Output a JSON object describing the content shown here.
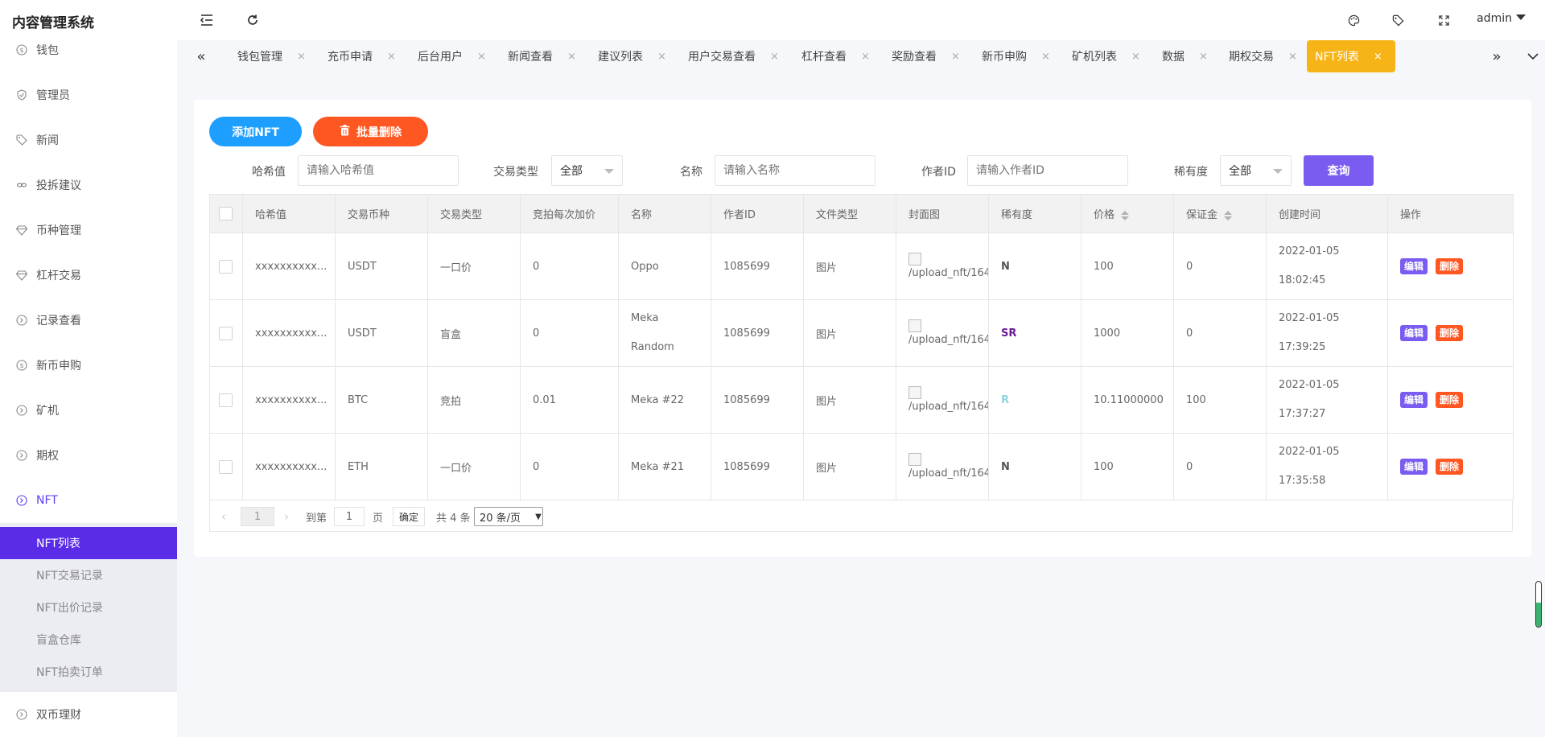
{
  "app_title": "内容管理系统",
  "header": {
    "user": "admin"
  },
  "sidebar": {
    "items": [
      {
        "label": "钱包",
        "icon": "dollar-circle-icon"
      },
      {
        "label": "管理员",
        "icon": "shield-icon"
      },
      {
        "label": "新闻",
        "icon": "tag-icon"
      },
      {
        "label": "投拆建议",
        "icon": "link-icon"
      },
      {
        "label": "币种管理",
        "icon": "diamond-icon"
      },
      {
        "label": "杠杆交易",
        "icon": "diamond-icon"
      },
      {
        "label": "记录查看",
        "icon": "circle-arrow-icon"
      },
      {
        "label": "新币申购",
        "icon": "dollar-circle-icon"
      },
      {
        "label": "矿机",
        "icon": "circle-arrow-icon"
      },
      {
        "label": "期权",
        "icon": "circle-arrow-icon"
      },
      {
        "label": "NFT",
        "icon": "circle-arrow-icon"
      },
      {
        "label": "双币理财",
        "icon": "circle-arrow-icon"
      }
    ],
    "nft_sub": [
      "NFT列表",
      "NFT交易记录",
      "NFT出价记录",
      "盲盒仓库",
      "NFT拍卖订单"
    ]
  },
  "tabs": [
    "钱包管理",
    "充币申请",
    "后台用户",
    "新闻查看",
    "建议列表",
    "用户交易查看",
    "杠杆查看",
    "奖励查看",
    "新币申购",
    "矿机列表",
    "数据",
    "期权交易",
    "NFT列表"
  ],
  "toolbar": {
    "add_label": "添加NFT",
    "batch_delete_label": "批量删除"
  },
  "filters": {
    "hash_label": "哈希值",
    "hash_placeholder": "请输入哈希值",
    "trade_type_label": "交易类型",
    "trade_type_value": "全部",
    "name_label": "名称",
    "name_placeholder": "请输入名称",
    "author_label": "作者ID",
    "author_placeholder": "请输入作者ID",
    "rarity_label": "稀有度",
    "rarity_value": "全部",
    "query_label": "查询"
  },
  "table": {
    "columns": [
      "哈希值",
      "交易币种",
      "交易类型",
      "竞拍每次加价",
      "名称",
      "作者ID",
      "文件类型",
      "封面图",
      "稀有度",
      "价格",
      "保证金",
      "创建时间",
      "操作"
    ],
    "rows": [
      {
        "hash": "xxxxxxxxxx...",
        "coin": "USDT",
        "type": "一口价",
        "increment": "0",
        "name": "Oppo",
        "author": "1085699",
        "file_type": "图片",
        "cover": "/upload_nft/1641",
        "rarity": "N",
        "rarity_color": "#555555",
        "price": "100",
        "deposit": "0",
        "date": "2022-01-05",
        "time": "18:02:45"
      },
      {
        "hash": "xxxxxxxxxx...",
        "coin": "USDT",
        "type": "盲盒",
        "increment": "0",
        "name": "Meka Random",
        "author": "1085699",
        "file_type": "图片",
        "cover": "/upload_nft/1641",
        "rarity": "SR",
        "rarity_color": "#6a1b9a",
        "price": "1000",
        "deposit": "0",
        "date": "2022-01-05",
        "time": "17:39:25"
      },
      {
        "hash": "xxxxxxxxxx...",
        "coin": "BTC",
        "type": "竞拍",
        "increment": "0.01",
        "name": "Meka #22",
        "author": "1085699",
        "file_type": "图片",
        "cover": "/upload_nft/1641",
        "rarity": "R",
        "rarity_color": "#8fd3df",
        "price": "10.11000000",
        "deposit": "100",
        "date": "2022-01-05",
        "time": "17:37:27"
      },
      {
        "hash": "xxxxxxxxxx...",
        "coin": "ETH",
        "type": "一口价",
        "increment": "0",
        "name": "Meka #21",
        "author": "1085699",
        "file_type": "图片",
        "cover": "/upload_nft/1641",
        "rarity": "N",
        "rarity_color": "#555555",
        "price": "100",
        "deposit": "0",
        "date": "2022-01-05",
        "time": "17:35:58"
      }
    ],
    "edit_label": "编辑",
    "delete_label": "删除"
  },
  "pagination": {
    "current_page": "1",
    "goto_label": "到第",
    "goto_value": "1",
    "page_unit": "页",
    "confirm_label": "确定",
    "total_label": "共 4 条",
    "page_size": "20 条/页"
  },
  "colors": {
    "accent": "#5b2ce8",
    "active_tab": "#f7b416",
    "add_button": "#1e9fff",
    "delete_button": "#ff5722",
    "query_button": "#7b5cf0"
  }
}
